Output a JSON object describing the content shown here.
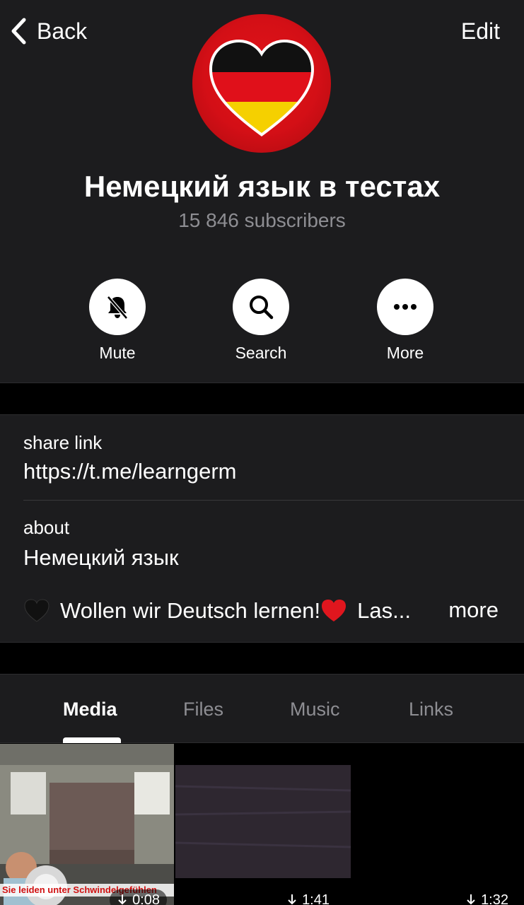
{
  "nav": {
    "back_label": "Back",
    "edit_label": "Edit"
  },
  "channel": {
    "title": "Немецкий язык в тестах",
    "subscribers": "15 846 subscribers"
  },
  "actions": [
    {
      "label": "Mute",
      "icon": "bell-slash-icon"
    },
    {
      "label": "Search",
      "icon": "search-icon"
    },
    {
      "label": "More",
      "icon": "more-dots-icon"
    }
  ],
  "info": {
    "share_label": "share link",
    "share_value": "https://t.me/learngerm",
    "about_label": "about",
    "about_value": "Немецкий язык",
    "about_line": "Wollen wir Deutsch lernen!",
    "about_trail": "Las...",
    "more_label": "more"
  },
  "tabs": [
    {
      "label": "Media",
      "active": true
    },
    {
      "label": "Files",
      "active": false
    },
    {
      "label": "Music",
      "active": false
    },
    {
      "label": "Links",
      "active": false
    }
  ],
  "media": [
    {
      "duration": "0:08",
      "caption": "Sie leiden unter Schwindelgefühlen"
    },
    {
      "duration": "1:41"
    },
    {
      "duration": "1:32"
    }
  ],
  "colors": {
    "background": "#000000",
    "surface": "#1c1c1e",
    "secondary_text": "#8e8e93",
    "avatar_red": "#d40f16"
  }
}
